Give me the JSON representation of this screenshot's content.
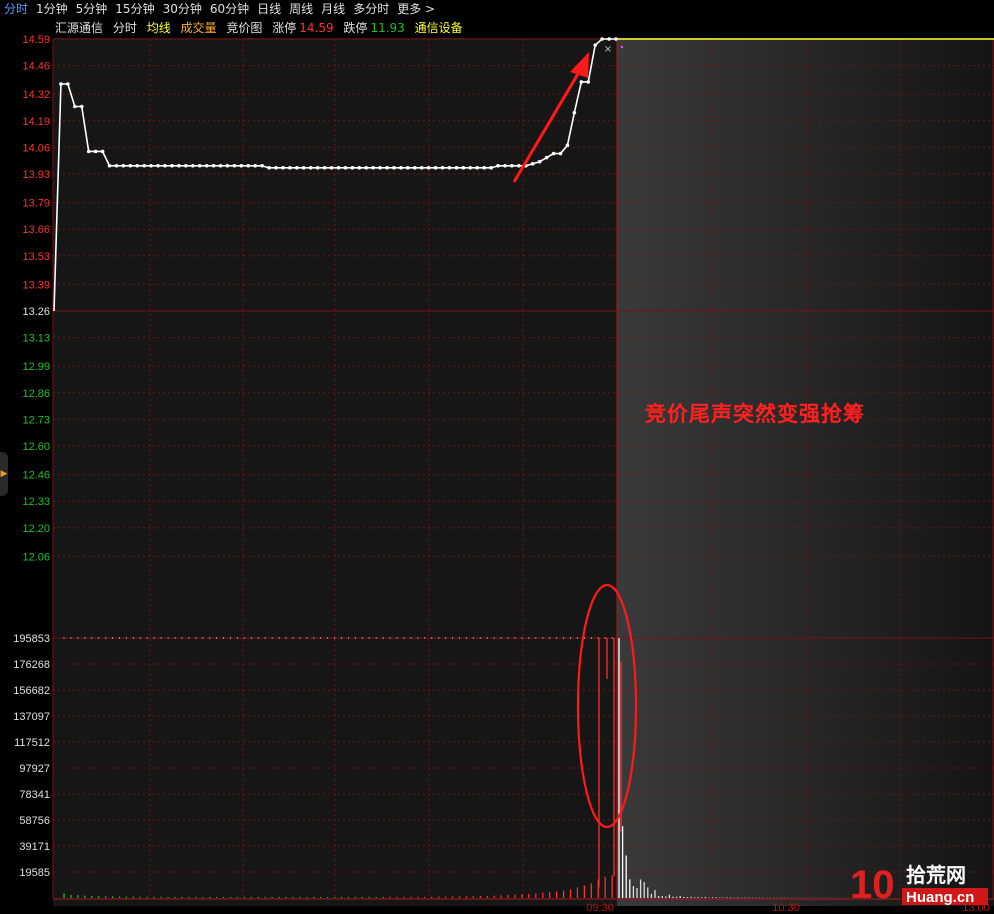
{
  "tabs": [
    "分时",
    "1分钟",
    "5分钟",
    "15分钟",
    "30分钟",
    "60分钟",
    "日线",
    "周线",
    "月线",
    "多分时",
    "更多 >"
  ],
  "active_tab": "分时",
  "info": {
    "stock_name": "汇源通信",
    "mode": "分时",
    "avg_line": "均线",
    "volume": "成交量",
    "auction": "竞价图",
    "limit_up_label": "涨停",
    "limit_up_value": "14.59",
    "limit_down_label": "跌停",
    "limit_down_value": "11.93",
    "sector": "通信设备"
  },
  "colors": {
    "up": "#ff3030",
    "down": "#20c020",
    "grid": "#7a1010",
    "line": "#ffffff",
    "avg": "#ffff30",
    "annotation": "#ff2020"
  },
  "annotation_text": "竞价尾声突然变强抢筹",
  "icons": {
    "cursor": "x-mark-icon",
    "side": "chevron-right-icon"
  },
  "logo": {
    "number": "10",
    "name_cn": "拾荒网",
    "domain": "Huang.cn"
  },
  "chart_data": {
    "type": "line",
    "price_axis": {
      "ticks_up": [
        "14.59",
        "14.46",
        "14.32",
        "14.19",
        "14.06",
        "13.93",
        "13.79",
        "13.66",
        "13.53",
        "13.39"
      ],
      "prev_close": "13.26",
      "ticks_down": [
        "13.13",
        "12.99",
        "12.86",
        "12.73",
        "12.60",
        "12.46",
        "12.33",
        "12.20",
        "12.06"
      ],
      "ylim": [
        11.93,
        14.59
      ]
    },
    "volume_axis": {
      "ticks": [
        "195853",
        "176268",
        "156682",
        "137097",
        "117512",
        "97927",
        "78341",
        "58756",
        "39171",
        "19585"
      ],
      "ylim": [
        0,
        215438
      ]
    },
    "time_axis": {
      "ticks": [
        "09:30",
        "10:30",
        "13:00"
      ]
    },
    "auction_price": [
      13.26,
      14.37,
      14.37,
      14.26,
      14.26,
      14.04,
      14.04,
      14.04,
      13.97,
      13.97,
      13.97,
      13.97,
      13.97,
      13.97,
      13.97,
      13.97,
      13.97,
      13.97,
      13.97,
      13.97,
      13.97,
      13.97,
      13.97,
      13.97,
      13.97,
      13.97,
      13.97,
      13.97,
      13.97,
      13.97,
      13.97,
      13.96,
      13.96,
      13.96,
      13.96,
      13.96,
      13.96,
      13.96,
      13.96,
      13.96,
      13.96,
      13.96,
      13.96,
      13.96,
      13.96,
      13.96,
      13.96,
      13.96,
      13.96,
      13.96,
      13.96,
      13.96,
      13.96,
      13.96,
      13.96,
      13.96,
      13.96,
      13.96,
      13.96,
      13.96,
      13.96,
      13.96,
      13.96,
      13.96,
      13.97,
      13.97,
      13.97,
      13.97,
      13.97,
      13.98,
      13.99,
      14.01,
      14.03,
      14.03,
      14.07,
      14.23,
      14.38,
      14.38,
      14.56,
      14.59,
      14.59,
      14.59
    ],
    "auction_volume": [
      3500,
      2200,
      2200,
      1800,
      1600,
      1400,
      1200,
      1200,
      1100,
      1000,
      1000,
      900,
      900,
      900,
      900,
      800,
      800,
      800,
      800,
      800,
      800,
      800,
      800,
      800,
      800,
      800,
      800,
      800,
      800,
      800,
      800,
      800,
      800,
      800,
      800,
      800,
      800,
      800,
      800,
      800,
      800,
      800,
      800,
      800,
      800,
      800,
      800,
      900,
      900,
      900,
      900,
      900,
      900,
      1000,
      1000,
      1000,
      1200,
      1200,
      1300,
      1400,
      1500,
      1600,
      1800,
      2000,
      2200,
      2500,
      2800,
      3200,
      3500,
      4000,
      4500,
      5000,
      5500,
      6500,
      8000,
      9500,
      11000,
      14000,
      16000,
      17000,
      17000,
      16000
    ],
    "unmatched_bars": [
      {
        "idx": 78,
        "value": 195853,
        "to": 8000
      },
      {
        "idx": 79,
        "value": 195853,
        "to": 165000
      },
      {
        "idx": 80,
        "value": 195853,
        "to": 16000
      },
      {
        "idx": 81,
        "value": 178000,
        "to": 50000
      }
    ],
    "session_volume": [
      195853,
      54000,
      32000,
      14000,
      9000,
      7500,
      14000,
      12000,
      8000,
      3000,
      6000,
      1500,
      1500,
      1200,
      2500,
      1000,
      900,
      1500,
      800,
      700,
      900,
      600,
      700,
      500,
      800,
      400,
      600,
      500,
      400,
      300,
      500,
      400,
      300,
      400,
      300,
      350,
      300,
      300,
      250,
      300,
      250,
      200,
      250,
      200,
      180,
      200,
      180,
      150,
      170,
      150,
      140,
      120,
      130,
      110,
      120,
      100,
      110,
      100,
      90,
      100,
      80,
      90,
      70,
      80,
      70,
      60,
      70,
      60,
      50,
      60
    ]
  }
}
